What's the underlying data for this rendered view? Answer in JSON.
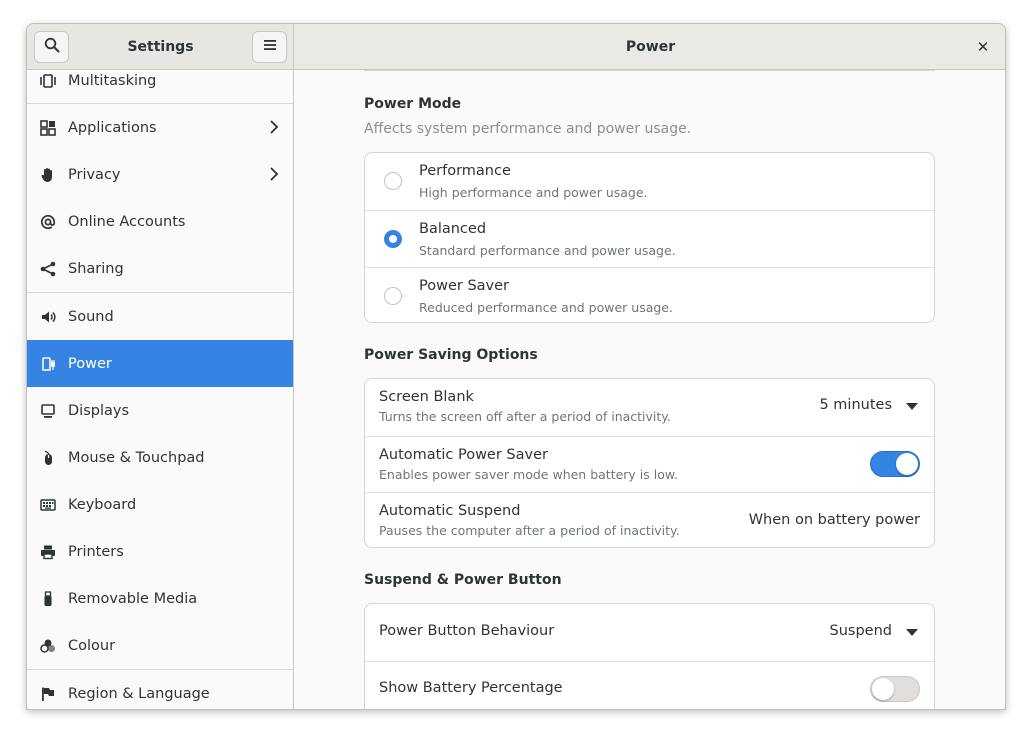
{
  "window": {
    "sidebar_title": "Settings",
    "panel_title": "Power",
    "close_glyph": "✕"
  },
  "sidebar": {
    "items": [
      {
        "label": "Multitasking",
        "icon": "multitasking-icon"
      },
      {
        "label": "Applications",
        "icon": "applications-icon",
        "chevron": true
      },
      {
        "label": "Privacy",
        "icon": "privacy-hand-icon",
        "chevron": true
      },
      {
        "label": "Online Accounts",
        "icon": "at-sign-icon"
      },
      {
        "label": "Sharing",
        "icon": "share-icon"
      },
      {
        "label": "Sound",
        "icon": "speaker-icon"
      },
      {
        "label": "Power",
        "icon": "power-plug-icon",
        "selected": true
      },
      {
        "label": "Displays",
        "icon": "display-icon"
      },
      {
        "label": "Mouse & Touchpad",
        "icon": "mouse-icon"
      },
      {
        "label": "Keyboard",
        "icon": "keyboard-icon"
      },
      {
        "label": "Printers",
        "icon": "printer-icon"
      },
      {
        "label": "Removable Media",
        "icon": "usb-icon"
      },
      {
        "label": "Colour",
        "icon": "colour-icon"
      },
      {
        "label": "Region & Language",
        "icon": "flag-icon"
      }
    ]
  },
  "power_mode": {
    "title": "Power Mode",
    "subtitle": "Affects system performance and power usage.",
    "options": [
      {
        "title": "Performance",
        "subtitle": "High performance and power usage.",
        "selected": false
      },
      {
        "title": "Balanced",
        "subtitle": "Standard performance and power usage.",
        "selected": true
      },
      {
        "title": "Power Saver",
        "subtitle": "Reduced performance and power usage.",
        "selected": false
      }
    ]
  },
  "power_saving": {
    "title": "Power Saving Options",
    "rows": [
      {
        "title": "Screen Blank",
        "subtitle": "Turns the screen off after a period of inactivity.",
        "value": "5 minutes"
      },
      {
        "title": "Automatic Power Saver",
        "subtitle": "Enables power saver mode when battery is low.",
        "switch_on": true
      },
      {
        "title": "Automatic Suspend",
        "subtitle": "Pauses the computer after a period of inactivity.",
        "value": "When on battery power"
      }
    ]
  },
  "suspend": {
    "title": "Suspend & Power Button",
    "rows": [
      {
        "title": "Power Button Behaviour",
        "value": "Suspend"
      },
      {
        "title": "Show Battery Percentage",
        "switch_on": false
      }
    ]
  },
  "colors": {
    "accent": "#3584e4",
    "header_bg": "#ebe9e6",
    "window_bg": "#fafafa"
  }
}
